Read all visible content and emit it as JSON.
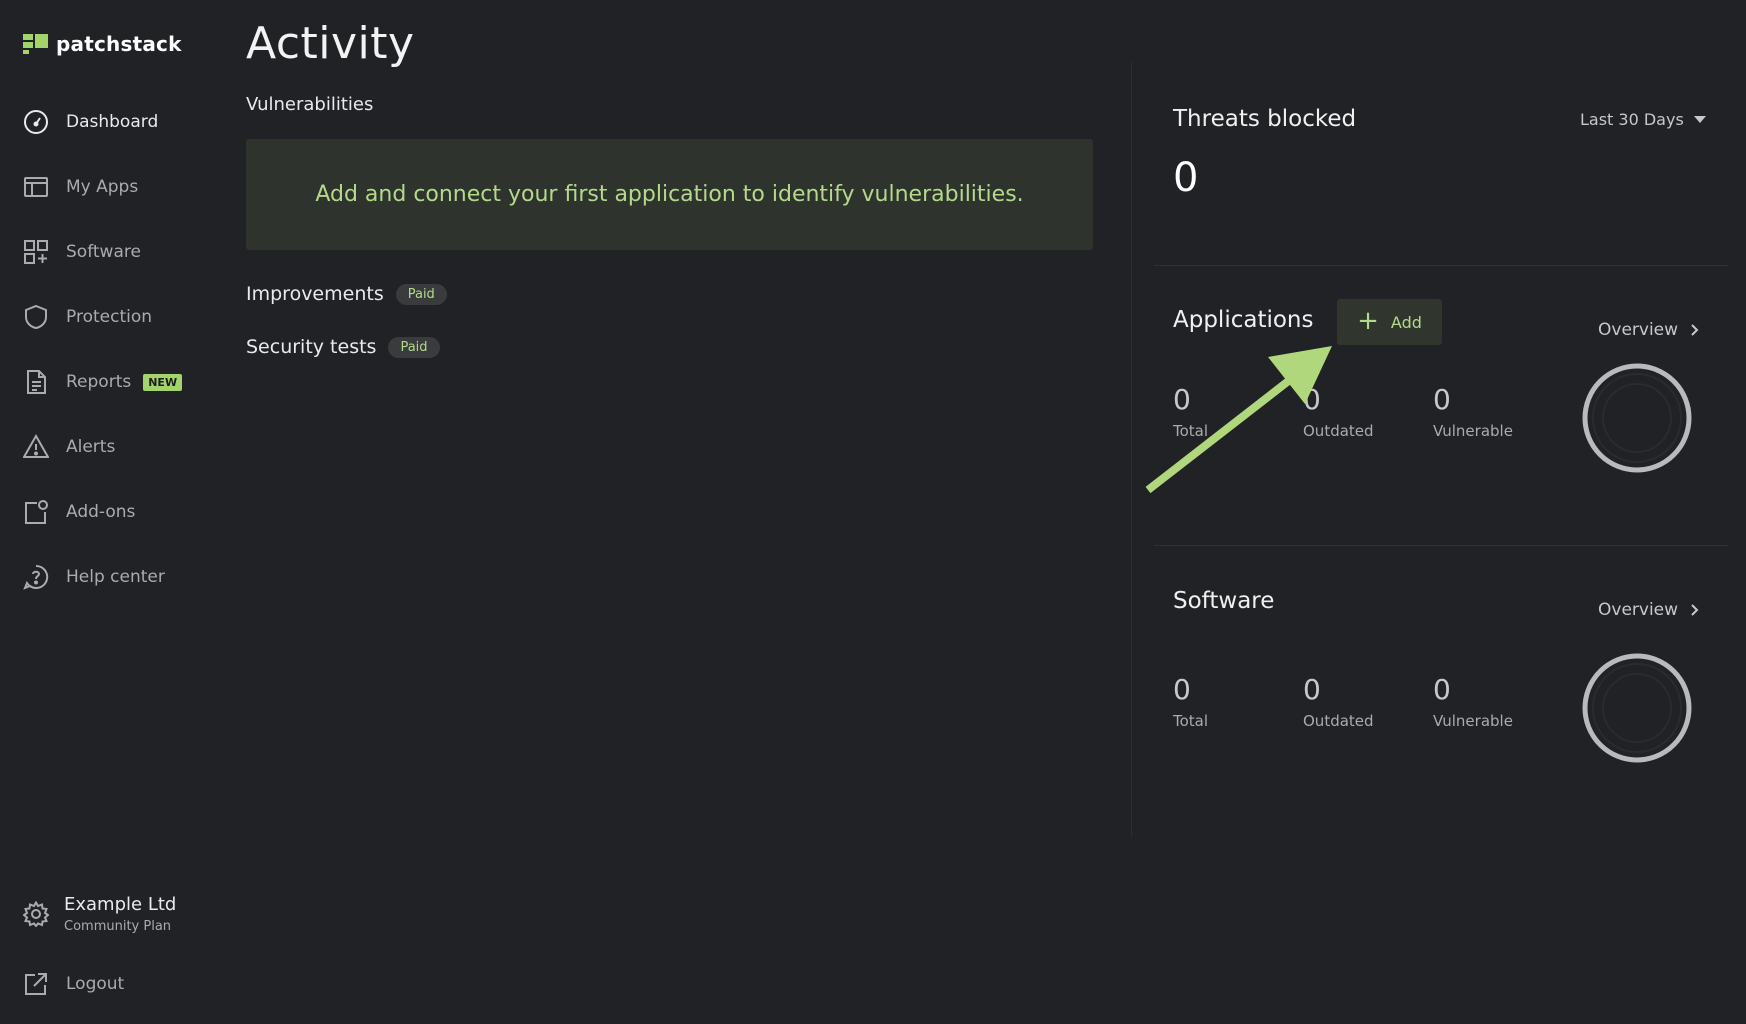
{
  "brand": {
    "name": "patchstack",
    "accent": "#a3d36b"
  },
  "sidebar": {
    "items": [
      {
        "label": "Dashboard",
        "icon": "gauge-icon"
      },
      {
        "label": "My Apps",
        "icon": "layout-icon"
      },
      {
        "label": "Software",
        "icon": "grid-plus-icon"
      },
      {
        "label": "Protection",
        "icon": "shield-icon"
      },
      {
        "label": "Reports",
        "icon": "document-icon",
        "badge": "NEW"
      },
      {
        "label": "Alerts",
        "icon": "warning-icon"
      },
      {
        "label": "Add-ons",
        "icon": "addon-icon"
      },
      {
        "label": "Help center",
        "icon": "help-icon"
      }
    ],
    "org": {
      "name": "Example Ltd",
      "plan": "Community Plan"
    },
    "logout": "Logout"
  },
  "main": {
    "title": "Activity",
    "vulnerabilities": {
      "label": "Vulnerabilities",
      "empty_message": "Add and connect your first application to identify vulnerabilities."
    },
    "improvements": {
      "label": "Improvements",
      "badge": "Paid"
    },
    "security_tests": {
      "label": "Security tests",
      "badge": "Paid"
    }
  },
  "threats": {
    "title": "Threats blocked",
    "range": "Last 30 Days",
    "value": "0"
  },
  "applications": {
    "title": "Applications",
    "add_label": "Add",
    "overview_label": "Overview",
    "stats": [
      {
        "value": "0",
        "label": "Total"
      },
      {
        "value": "0",
        "label": "Outdated"
      },
      {
        "value": "0",
        "label": "Vulnerable"
      }
    ]
  },
  "software": {
    "title": "Software",
    "overview_label": "Overview",
    "stats": [
      {
        "value": "0",
        "label": "Total"
      },
      {
        "value": "0",
        "label": "Outdated"
      },
      {
        "value": "0",
        "label": "Vulnerable"
      }
    ]
  }
}
